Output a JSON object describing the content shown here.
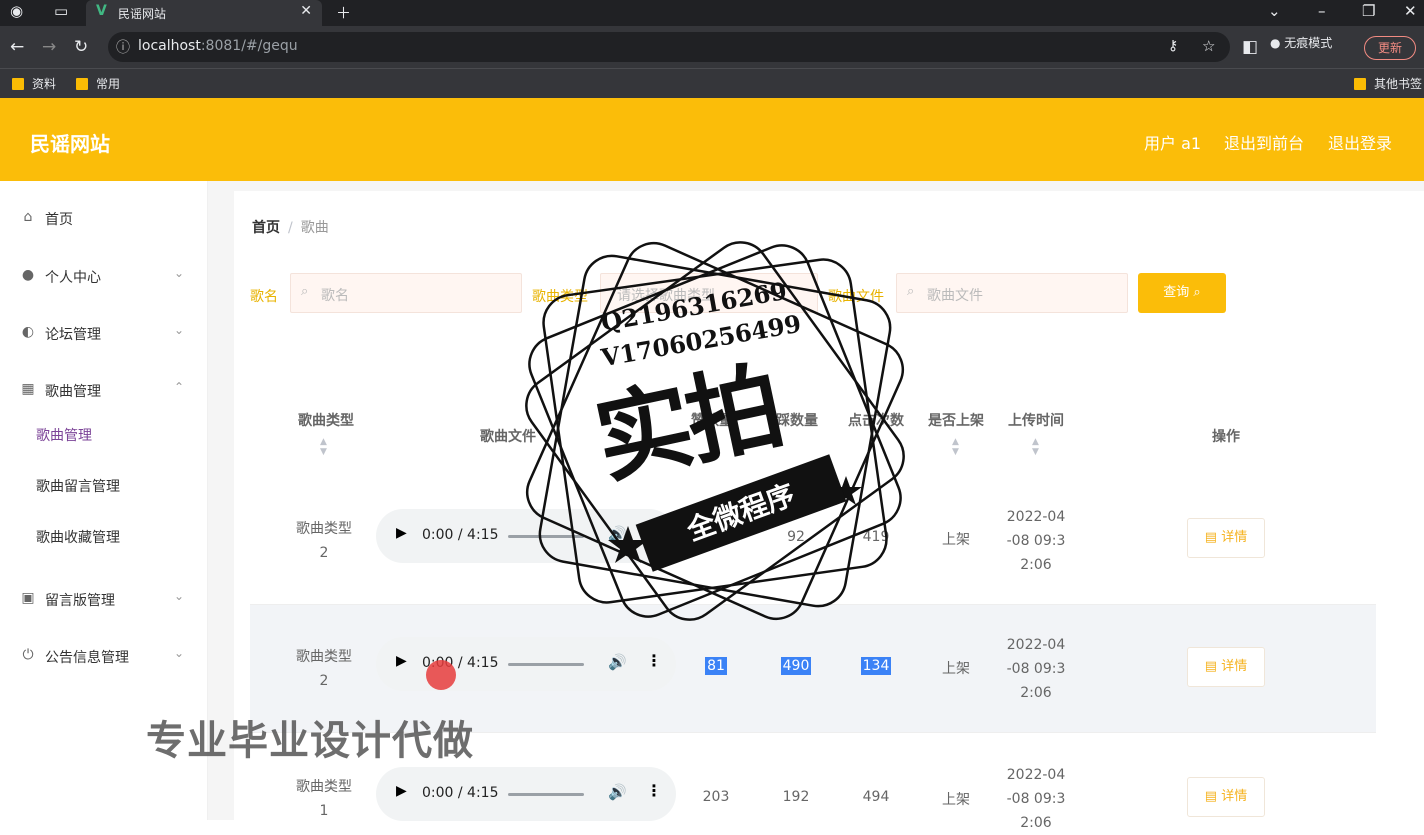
{
  "browser": {
    "tab_title": "民谣网站",
    "tab_logo": "V",
    "url_host": "localhost",
    "url_rest": ":8081/#/gequ",
    "incognito_label": "无痕模式",
    "update_label": "更新",
    "bookmarks": [
      "资料",
      "常用"
    ],
    "other_bookmarks": "其他书签"
  },
  "header": {
    "brand": "民谣网站",
    "user": "用户 a1",
    "to_front": "退出到前台",
    "logout": "退出登录"
  },
  "sidebar": {
    "items": [
      {
        "label": "首页",
        "icon": "home-icon"
      },
      {
        "label": "个人中心",
        "icon": "user-icon"
      },
      {
        "label": "论坛管理",
        "icon": "bulb-icon"
      },
      {
        "label": "歌曲管理",
        "icon": "grid-icon"
      },
      {
        "label": "留言版管理",
        "icon": "trash-icon"
      },
      {
        "label": "公告信息管理",
        "icon": "power-icon"
      }
    ],
    "sub_items": [
      "歌曲管理",
      "歌曲留言管理",
      "歌曲收藏管理"
    ]
  },
  "breadcrumb": {
    "home": "首页",
    "current": "歌曲"
  },
  "filters": {
    "name_label": "歌名",
    "name_placeholder": "歌名",
    "type_label": "歌曲类型",
    "type_placeholder": "请选择歌曲类型",
    "file_label": "歌曲文件",
    "file_placeholder": "歌曲文件",
    "search_button": "查询"
  },
  "table": {
    "headers": [
      "歌曲类型",
      "歌曲文件",
      "赞数量",
      "踩数量",
      "点击次数",
      "是否上架",
      "上传时间",
      "操作"
    ],
    "rows": [
      {
        "type": [
          "歌曲类型",
          "2"
        ],
        "time_display": "0:00 / 4:15",
        "likes": "",
        "dislikes": "92",
        "clicks": "419",
        "status": "上架",
        "upload": [
          "2022-04",
          "-08 09:3",
          "2:06"
        ],
        "action": "详情"
      },
      {
        "type": [
          "歌曲类型",
          "2"
        ],
        "time_display": "0:00 / 4:15",
        "likes": "81",
        "dislikes": "490",
        "clicks": "134",
        "status": "上架",
        "upload": [
          "2022-04",
          "-08 09:3",
          "2:06"
        ],
        "action": "详情"
      },
      {
        "type": [
          "歌曲类型",
          "1"
        ],
        "time_display": "0:00 / 4:15",
        "likes": "203",
        "dislikes": "192",
        "clicks": "494",
        "status": "上架",
        "upload": [
          "2022-04",
          "-08 09:3",
          "2:06"
        ],
        "action": "详情"
      }
    ]
  },
  "stamp": {
    "q": "Q2196316269",
    "v": "V17060256499",
    "big": "实拍",
    "banner": "全微程序"
  },
  "watermark": "专业毕业设计代做",
  "colors": {
    "accent": "#fbbd09",
    "active_menu": "#7b4397",
    "selection": "#3b82f6"
  }
}
